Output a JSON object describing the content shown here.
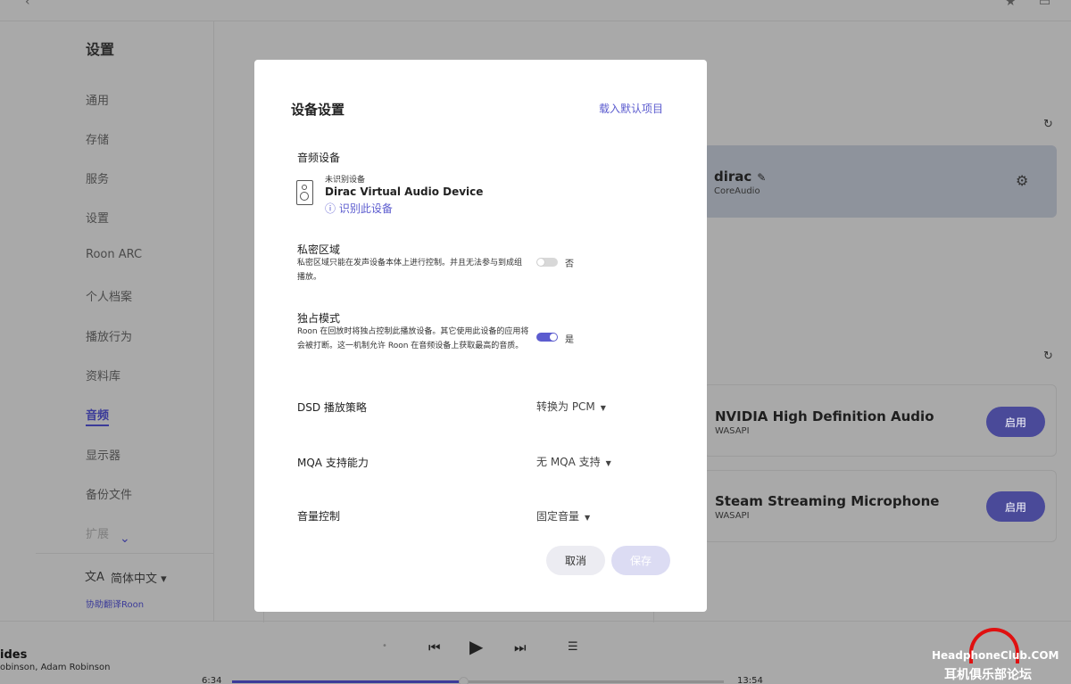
{
  "topbar": {
    "back_icon": "‹",
    "bell_icon": "★",
    "right_icon": "▭"
  },
  "sidebar": {
    "title": "设置",
    "items": [
      {
        "label": "通用"
      },
      {
        "label": "存储"
      },
      {
        "label": "服务"
      },
      {
        "label": "设置"
      },
      {
        "label": "Roon ARC"
      },
      {
        "label": "个人档案"
      },
      {
        "label": "播放行为"
      },
      {
        "label": "资料库"
      },
      {
        "label": "音频"
      },
      {
        "label": "显示器"
      },
      {
        "label": "备份文件"
      },
      {
        "label": "扩展"
      }
    ],
    "active_index": 8,
    "more_icon": "⌄",
    "language_icon": "文A",
    "language": "简体中文 ▾",
    "help_link": "协助翻译Roon"
  },
  "background_devices": {
    "refresh_icon": "↻",
    "selected": {
      "name": "dirac",
      "pencil_icon": "✎",
      "sub": "CoreAudio",
      "gear_icon": "⚙"
    },
    "others": [
      {
        "name": "NVIDIA High Definition Audio",
        "sub": "WASAPI",
        "button": "启用"
      },
      {
        "name": "Steam Streaming Microphone",
        "sub": "WASAPI",
        "button": "启用"
      }
    ]
  },
  "player": {
    "song": "ides",
    "artist": "obinson, Adam Robinson",
    "elapsed": "6:34",
    "total": "13:54",
    "progress": 0.47,
    "icons": {
      "dot": "•",
      "prev": "⏮",
      "play": "▶",
      "next": "⏭",
      "queue": "☰"
    }
  },
  "watermark": {
    "top": "HeadphoneClub.COM",
    "bottom": "耳机俱乐部论坛"
  },
  "modal": {
    "title": "设备设置",
    "reset_link": "载入默认项目",
    "audio_device": {
      "label": "音频设备",
      "note": "未识别设备",
      "name": "Dirac Virtual Audio Device",
      "identify": "ⓘ 识别此设备"
    },
    "private_zone": {
      "label": "私密区域",
      "desc": "私密区域只能在发声设备本体上进行控制。并且无法参与到成组播放。",
      "value": "否",
      "enabled": false
    },
    "exclusive_mode": {
      "label": "独占模式",
      "desc": "Roon 在回放时将独占控制此播放设备。其它使用此设备的应用将会被打断。这一机制允许 Roon 在音频设备上获取最高的音质。",
      "value": "是",
      "enabled": true
    },
    "dsd": {
      "label": "DSD 播放策略",
      "value": "转换为 PCM"
    },
    "mqa": {
      "label": "MQA 支持能力",
      "value": "无 MQA 支持"
    },
    "volume": {
      "label": "音量控制",
      "value": "固定音量"
    },
    "cancel_label": "取消",
    "save_label": "保存"
  }
}
